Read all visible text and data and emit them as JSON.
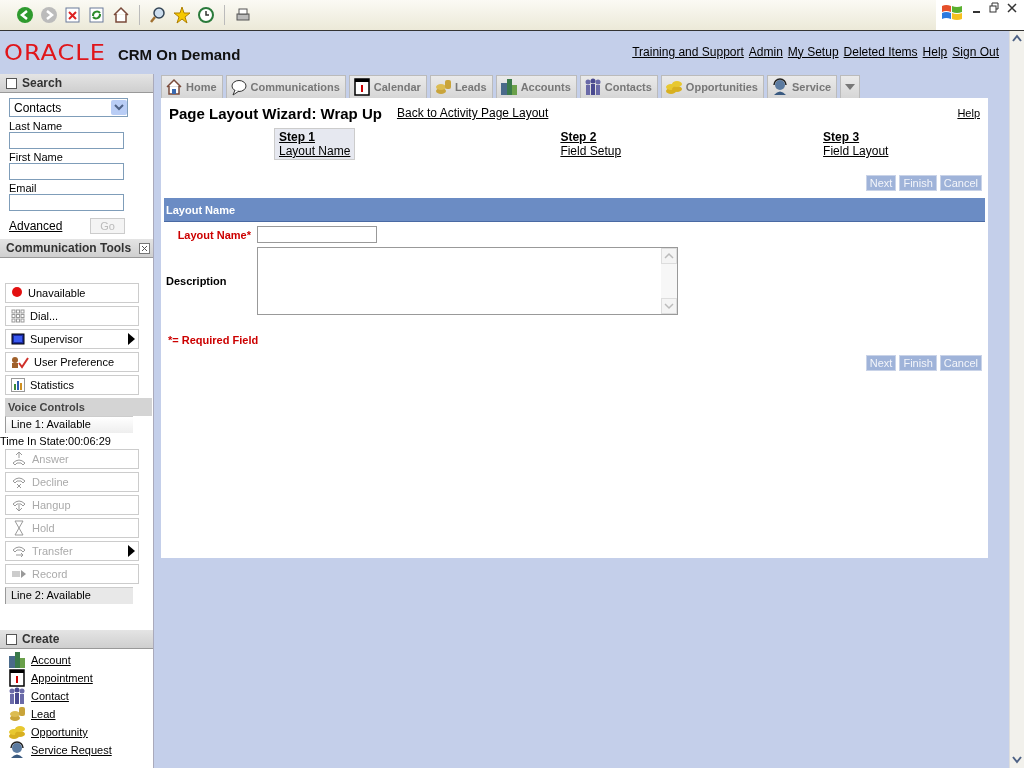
{
  "header": {
    "logo": "ORACLE",
    "product": "CRM On Demand",
    "links": [
      "Training and Support",
      "Admin",
      "My Setup",
      "Deleted Items",
      "Help",
      "Sign Out"
    ]
  },
  "search_panel": {
    "title": "Search",
    "record_type": "Contacts",
    "fields": [
      {
        "label": "Last Name"
      },
      {
        "label": "First Name"
      },
      {
        "label": "Email"
      }
    ],
    "advanced_link": "Advanced",
    "go_button": {
      "label": "Go",
      "disabled": true
    }
  },
  "communication_tools": {
    "title": "Communication Tools",
    "items": [
      {
        "label": "Unavailable",
        "kind": "status",
        "submenu": false
      },
      {
        "label": "Dial...",
        "kind": "dial",
        "submenu": false
      },
      {
        "label": "Supervisor",
        "kind": "supervisor",
        "submenu": true
      },
      {
        "label": "User Preference",
        "kind": "preference",
        "submenu": false
      },
      {
        "label": "Statistics",
        "kind": "statistics",
        "submenu": false
      }
    ]
  },
  "voice_controls": {
    "title": "Voice Controls",
    "line_1": "Line 1: Available",
    "time_in_state": "Time In State:00:06:29",
    "buttons": [
      {
        "label": "Answer",
        "kind": "answer",
        "disabled": true,
        "submenu": false
      },
      {
        "label": "Decline",
        "kind": "decline",
        "disabled": true,
        "submenu": false
      },
      {
        "label": "Hangup",
        "kind": "hangup",
        "disabled": true,
        "submenu": false
      },
      {
        "label": "Hold",
        "kind": "hold",
        "disabled": true,
        "submenu": false
      },
      {
        "label": "Transfer",
        "kind": "transfer",
        "disabled": true,
        "submenu": true
      },
      {
        "label": "Record",
        "kind": "record",
        "disabled": true,
        "submenu": false
      }
    ],
    "line_2": "Line 2: Available"
  },
  "create_panel": {
    "title": "Create",
    "items": [
      {
        "label": "Account",
        "kind": "account"
      },
      {
        "label": "Appointment",
        "kind": "calendar"
      },
      {
        "label": "Contact",
        "kind": "contacts"
      },
      {
        "label": "Lead",
        "kind": "lead"
      },
      {
        "label": "Opportunity",
        "kind": "coins"
      },
      {
        "label": "Service Request",
        "kind": "service"
      }
    ]
  },
  "tabs": [
    {
      "label": "Home",
      "kind": "home",
      "selected": false
    },
    {
      "label": "Communications",
      "kind": "speech",
      "selected": false
    },
    {
      "label": "Calendar",
      "kind": "calendar",
      "selected": false
    },
    {
      "label": "Leads",
      "kind": "lead",
      "selected": false
    },
    {
      "label": "Accounts",
      "kind": "account",
      "selected": false
    },
    {
      "label": "Contacts",
      "kind": "contacts",
      "selected": false
    },
    {
      "label": "Opportunities",
      "kind": "coins",
      "selected": false
    },
    {
      "label": "Service",
      "kind": "service",
      "selected": false
    }
  ],
  "wizard": {
    "title": "Page Layout Wizard: Wrap Up",
    "back_link": "Back to Activity Page Layout",
    "help_link": "Help",
    "steps": [
      {
        "step": "Step 1",
        "name": "Layout Name",
        "selected": true
      },
      {
        "step": "Step 2",
        "name": "Field Setup",
        "selected": false
      },
      {
        "step": "Step 3",
        "name": "Field Layout",
        "selected": false
      }
    ],
    "top_buttons": [
      {
        "label": "Next",
        "disabled": true
      },
      {
        "label": "Finish",
        "disabled": true
      },
      {
        "label": "Cancel",
        "disabled": true
      }
    ],
    "section_title": "Layout Name",
    "fields": [
      {
        "label": "Layout Name*",
        "kind": "text",
        "required": true
      },
      {
        "label": "Description",
        "kind": "textarea",
        "required": false
      }
    ],
    "required_note": "*= Required Field",
    "bottom_buttons": [
      {
        "label": "Next",
        "disabled": true
      },
      {
        "label": "Finish",
        "disabled": true
      },
      {
        "label": "Cancel",
        "disabled": true
      }
    ]
  }
}
